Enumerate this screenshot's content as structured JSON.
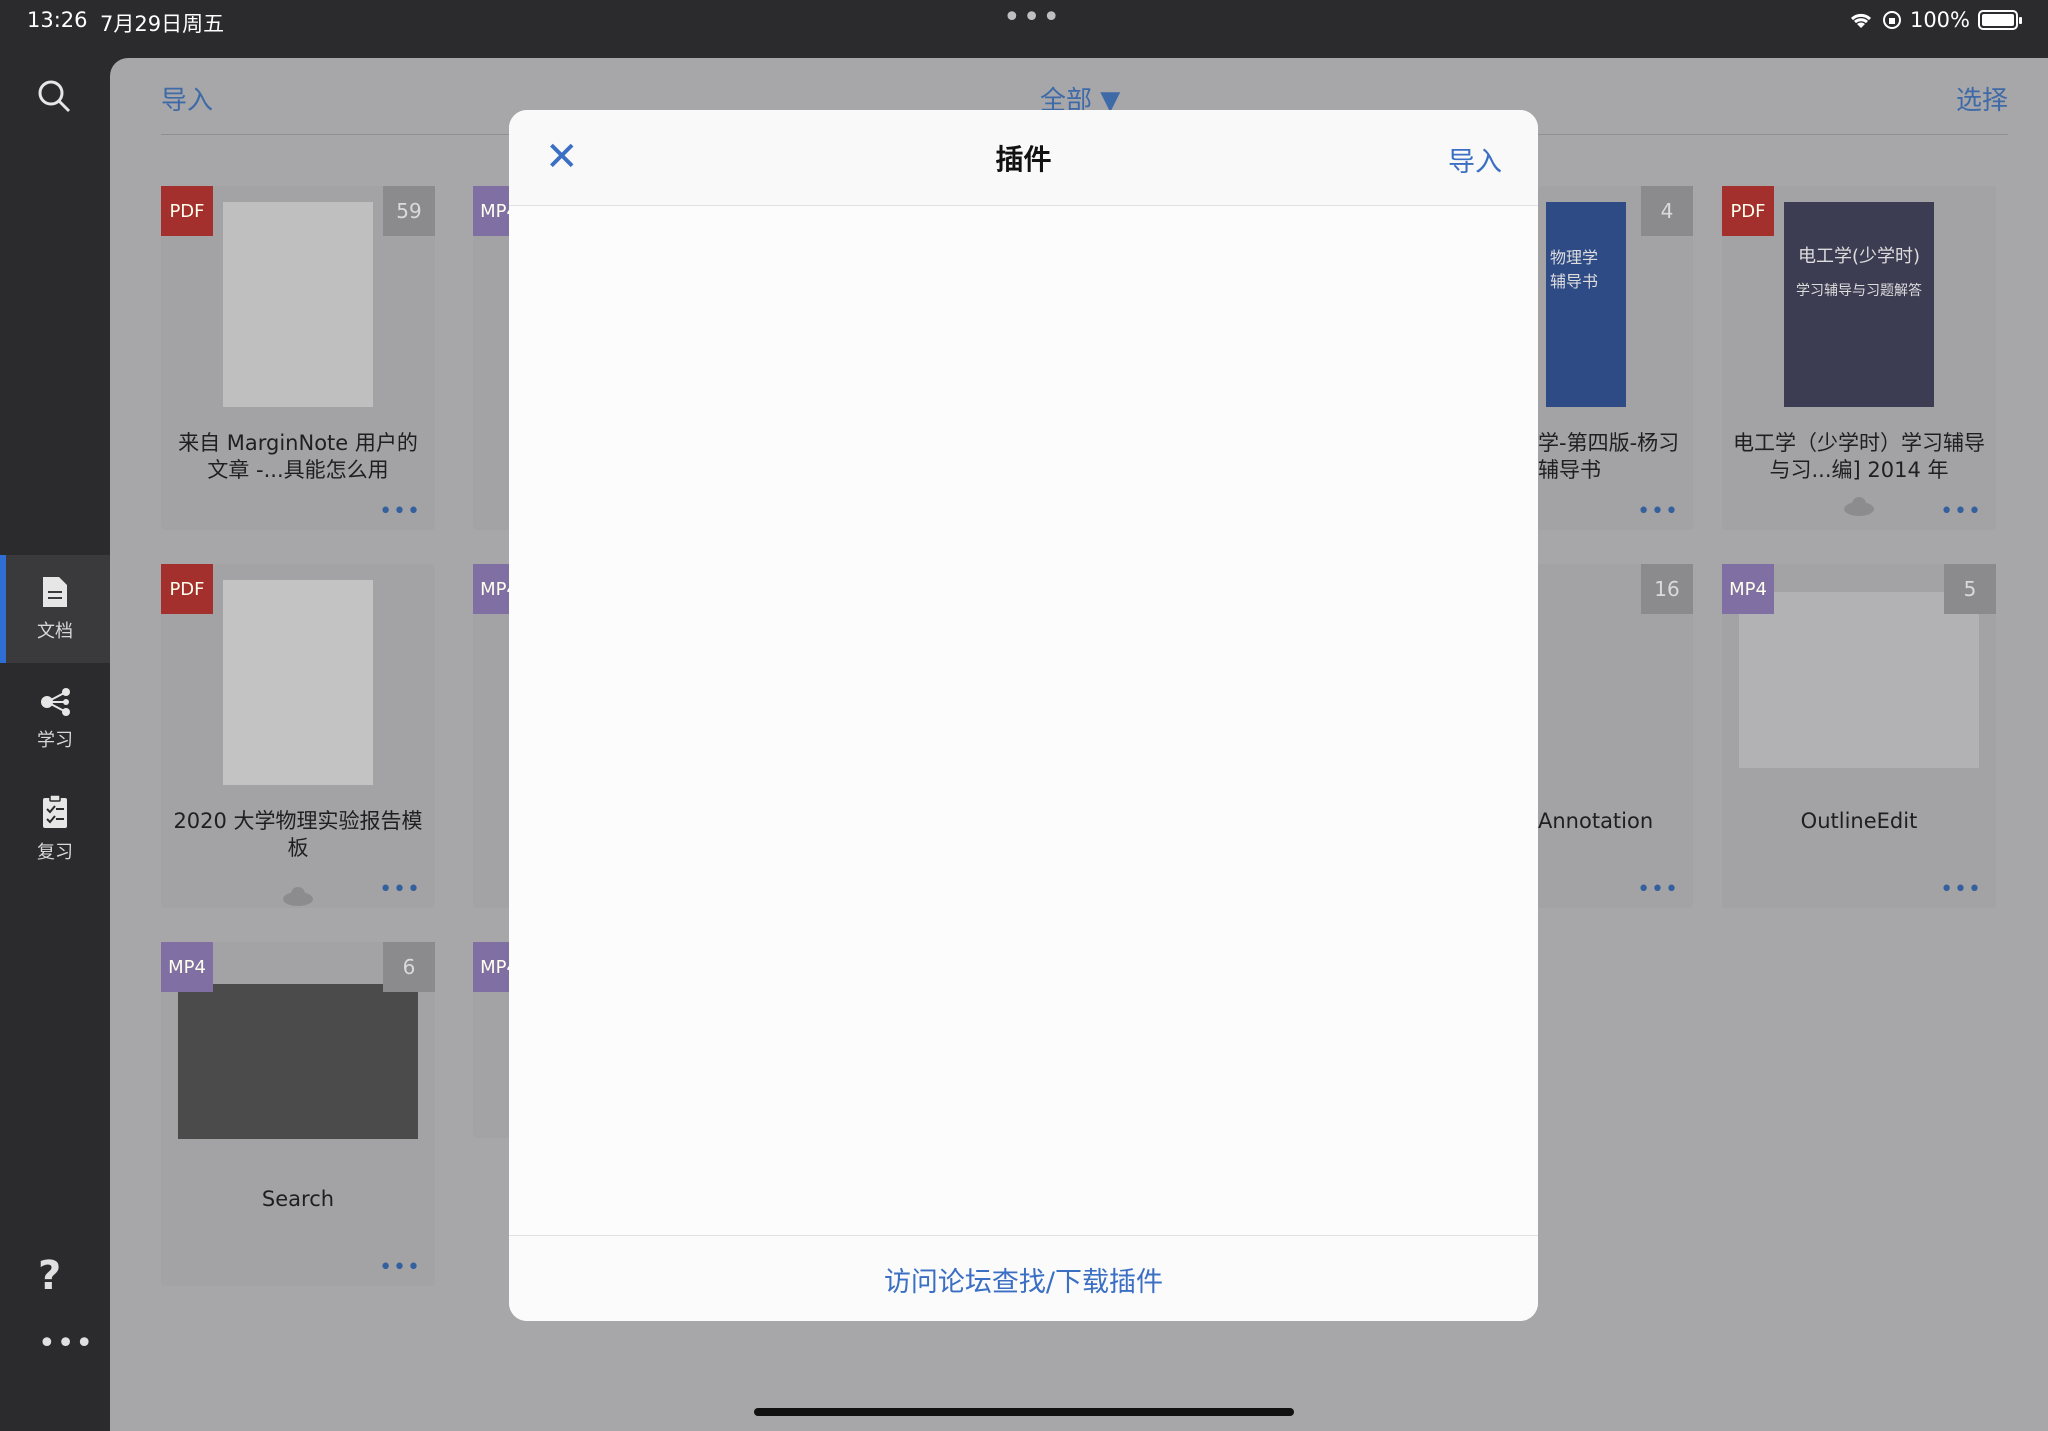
{
  "status": {
    "time": "13:26",
    "date": "7月29日周五",
    "dots": "•••",
    "battery_text": "100%"
  },
  "sidebar": {
    "items": [
      {
        "label": "文档",
        "icon": "document-icon",
        "active": true
      },
      {
        "label": "学习",
        "icon": "mindmap-icon",
        "active": false
      },
      {
        "label": "复习",
        "icon": "clipboard-check-icon",
        "active": false
      }
    ],
    "help": "?",
    "more": "•••"
  },
  "topbar": {
    "import_label": "导入",
    "filter_label": "全部 ▼",
    "select_label": "选择"
  },
  "cards": [
    {
      "type": "PDF",
      "count": "59",
      "title": "来自 MarginNote 用户的文章 -...具能怎么用",
      "dots": "•••"
    },
    {
      "type": "MP4",
      "count": "",
      "title": "",
      "dots": ""
    },
    {
      "type": "",
      "count": "4",
      "title": "学-第四版-杨习辅导书",
      "dots": "•••"
    },
    {
      "type": "PDF",
      "count": "",
      "title": "电工学（少学时）学习辅导与习...编] 2014 年",
      "dots": "•••"
    },
    {
      "type": "PDF",
      "count": "",
      "title": "2020 大学物理实验报告模板",
      "dots": "•••"
    },
    {
      "type": "MP4",
      "count": "",
      "title": "",
      "dots": ""
    },
    {
      "type": "",
      "count": "16",
      "title": "Annotation",
      "dots": "•••"
    },
    {
      "type": "MP4",
      "count": "5",
      "title": "OutlineEdit",
      "dots": "•••"
    },
    {
      "type": "MP4",
      "count": "6",
      "title": "Search",
      "dots": "•••"
    },
    {
      "type": "MP4",
      "count": "",
      "title": "",
      "dots": ""
    }
  ],
  "thumb_texts": {
    "book1_title": "电工学(少学时)",
    "book1_sub": "学习辅导与习题解答",
    "book2_title": "物理学",
    "book2_sub": "辅导书"
  },
  "modal": {
    "close_glyph": "✕",
    "title": "插件",
    "import_label": "导入",
    "footer_link": "访问论坛查找/下载插件"
  },
  "colors": {
    "accent": "#3a6fc4",
    "pdf_badge": "#a3302d",
    "mp4_badge": "#7f6fa3"
  }
}
